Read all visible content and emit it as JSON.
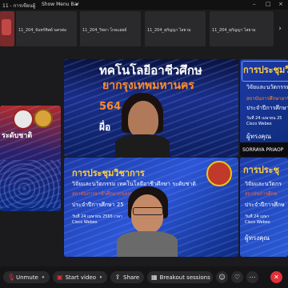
{
  "window": {
    "title": "11 - การเขียนผู้",
    "menu_bar_label": "Show Menu Bar",
    "menu_bar_chevron": "chevron-down-icon"
  },
  "thumbnails": [
    {
      "name": "11_204_จันทร์ทิพย์ นครต่อ"
    },
    {
      "name": "11_204_วิทยา โกลแอ่ยย์"
    },
    {
      "name": "11_204_สุกัญญา ไสยาม"
    },
    {
      "name": "11_204_สุกัญญา ไสยาม"
    }
  ],
  "slide_main": {
    "line1": "ทคโนโลยีอาชีวศึกษ",
    "line2": "ยากรุงเทพมหานคร",
    "line3": "564",
    "line4": "ผื่อ"
  },
  "slide_right": {
    "title": "การประชุมวิ",
    "line1": "วิจัยและนวัตกรรม",
    "line2": "สถาบันการศึกษาอาชีวศ",
    "line3": "ประจำปีการศึกษา",
    "line4": "วันที่ 24 เมษายน 25",
    "line5": "Cisco Webex",
    "line6": "ผู้ทรงคุณ",
    "participant": "SORRAYA PRIAOP"
  },
  "slide_left": {
    "text": "ระดับชาติ"
  },
  "slide_bottom": {
    "title": "การประชุมวิชาการ",
    "line1": "วิจัยและนวัตกรรม เทคโนโลยีอาชีวศึกษา ระดับชาติ",
    "line2": "สถาบันการอาชีวศึกษากรุงเทพมหานคร",
    "line3": "ประจำปีการศึกษา 25",
    "line4": "วันที่ 24 เมษายน 2565 เวลา",
    "line5": "Cisco Webex"
  },
  "slide_bottom_right": {
    "title": "การประชุ",
    "line1": "วิจัยและนวัตกร",
    "line2": "สถาบันการศึกษ",
    "line3": "ประจำปีการศึกษ",
    "line4": "วันที่ 24 เมษา",
    "line5": "Cisco Webex",
    "line6": "ผู้ทรงคุณ"
  },
  "controls": {
    "unmute": "Unmute",
    "start_video": "Start video",
    "share": "Share",
    "breakout": "Breakout sessions",
    "mic_icon": "mic-muted-icon",
    "video_icon": "video-off-icon",
    "share_icon": "share-icon",
    "breakout_icon": "breakout-icon",
    "react_icon": "emoji-icon",
    "more_icon": "more-icon",
    "end_icon": "end-call-icon"
  },
  "colors": {
    "accent_red": "#e0303a",
    "slide_title_yellow": "#ffd23a",
    "slide_text_orange": "#ff8c2a"
  }
}
